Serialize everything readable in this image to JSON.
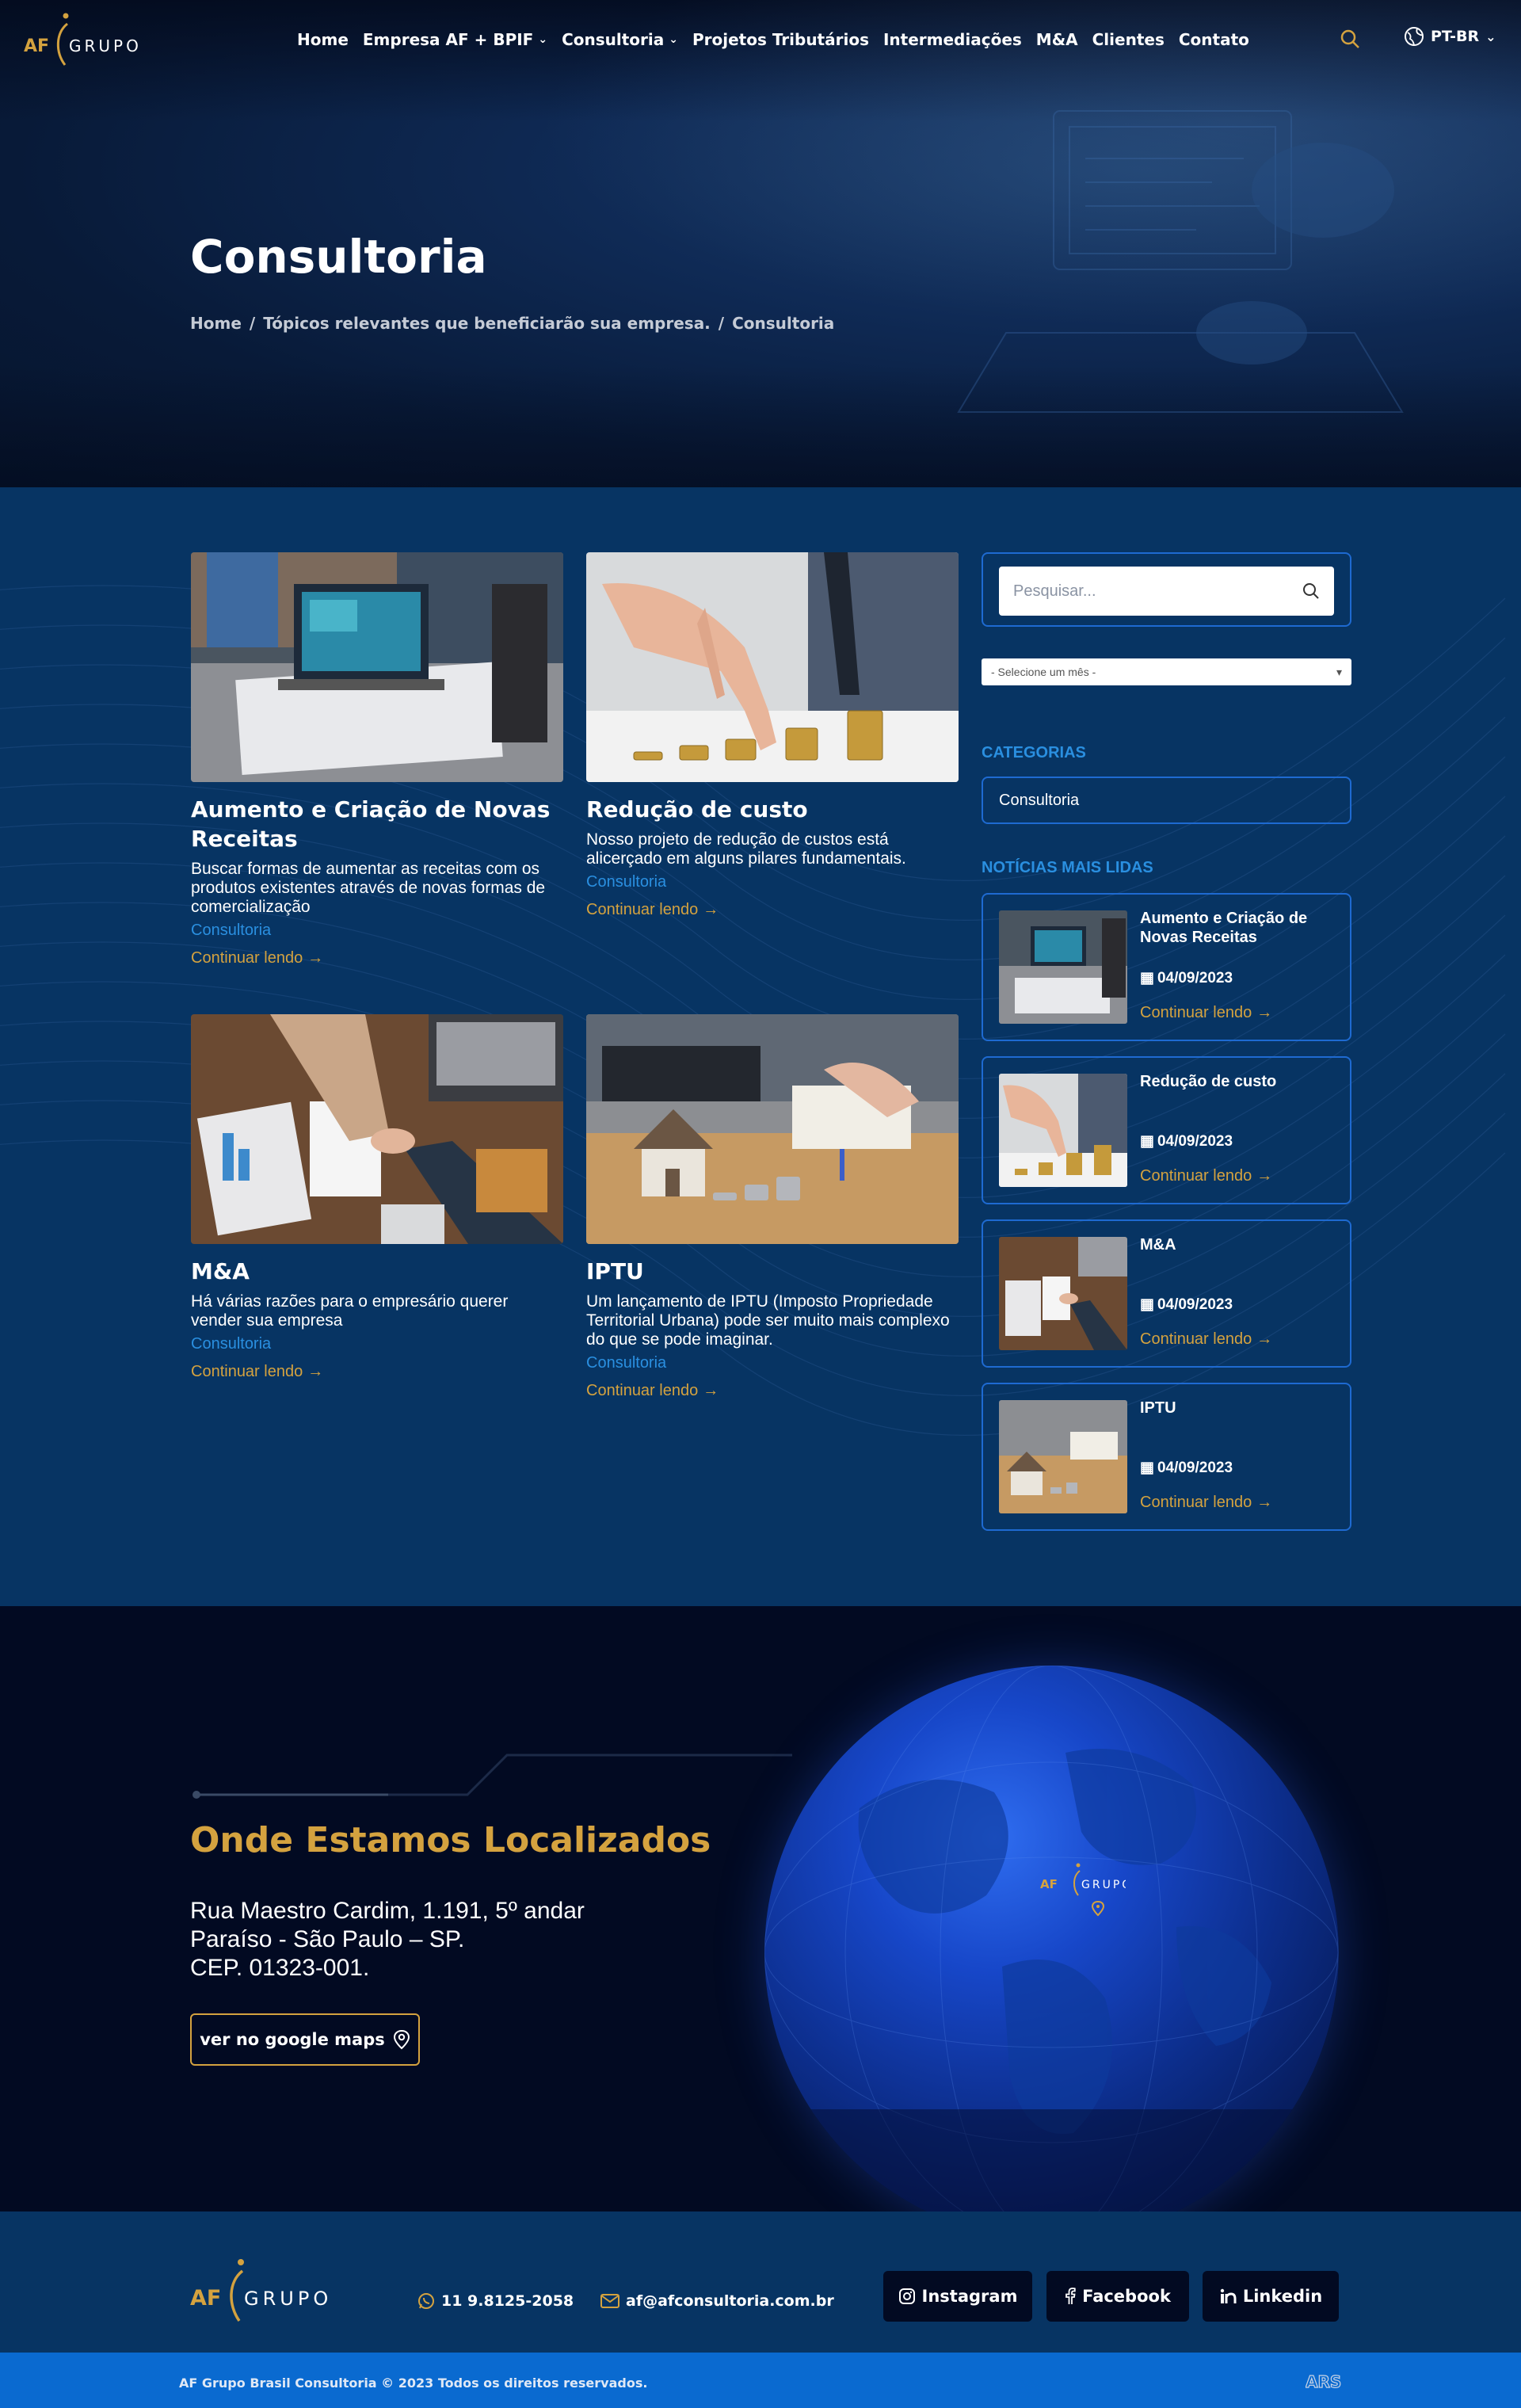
{
  "nav": {
    "logo_af": "AF",
    "logo_grupo": "GRUPO",
    "items": [
      {
        "label": "Home",
        "has_dropdown": false
      },
      {
        "label": "Empresa AF + BPIF",
        "has_dropdown": true
      },
      {
        "label": "Consultoria",
        "has_dropdown": true
      },
      {
        "label": "Projetos Tributários",
        "has_dropdown": false
      },
      {
        "label": "Intermediações",
        "has_dropdown": false
      },
      {
        "label": "M&A",
        "has_dropdown": false
      },
      {
        "label": "Clientes",
        "has_dropdown": false
      },
      {
        "label": "Contato",
        "has_dropdown": false
      }
    ],
    "language": "PT-BR"
  },
  "hero": {
    "title": "Consultoria",
    "breadcrumb": [
      "Home",
      "Tópicos relevantes que beneficiarão sua empresa.",
      "Consultoria"
    ],
    "separator": "/"
  },
  "posts": [
    {
      "title": "Aumento e Criação de Novas Receitas",
      "excerpt": "Buscar formas de aumentar as receitas com os produtos existentes através de novas formas de comercialização",
      "category": "Consultoria",
      "more": "Continuar lendo"
    },
    {
      "title": "Redução de custo",
      "excerpt": "Nosso projeto de redução de custos está alicerçado em alguns pilares fundamentais.",
      "category": "Consultoria",
      "more": "Continuar lendo"
    },
    {
      "title": "M&A",
      "excerpt": "Há várias razões para o empresário querer vender sua empresa",
      "category": "Consultoria",
      "more": "Continuar lendo"
    },
    {
      "title": "IPTU",
      "excerpt": "Um lançamento de IPTU (Imposto Propriedade Territorial Urbana) pode ser muito mais complexo do que se pode imaginar.",
      "category": "Consultoria",
      "more": "Continuar lendo"
    }
  ],
  "sidebar": {
    "search_placeholder": "Pesquisar...",
    "month_select": "- Selecione um mês -",
    "categories_heading": "CATEGORIAS",
    "categories": [
      "Consultoria"
    ],
    "popular_heading": "NOTÍCIAS MAIS LIDAS",
    "popular": [
      {
        "title": "Aumento e Criação de Novas Receitas",
        "date": "04/09/2023",
        "more": "Continuar lendo"
      },
      {
        "title": "Redução de custo",
        "date": "04/09/2023",
        "more": "Continuar lendo"
      },
      {
        "title": "M&A",
        "date": "04/09/2023",
        "more": "Continuar lendo"
      },
      {
        "title": "IPTU",
        "date": "04/09/2023",
        "more": "Continuar lendo"
      }
    ]
  },
  "location": {
    "title": "Onde Estamos Localizados",
    "address_line1": "Rua Maestro Cardim, 1.191, 5º andar",
    "address_line2": "Paraíso - São Paulo – SP.",
    "address_line3": "CEP. 01323-001.",
    "maps_button": "ver no google maps"
  },
  "footer": {
    "phone": "11 9.8125-2058",
    "email": "af@afconsultoria.com.br",
    "social": [
      "Instagram",
      "Facebook",
      "Linkedin"
    ],
    "copyright": "AF Grupo Brasil Consultoria © 2023 Todos os direitos reservados.",
    "credit": "ARS"
  },
  "colors": {
    "gold": "#d4a23f",
    "accent_blue": "#2a8fe0",
    "border_blue": "#1e6ad1",
    "section_blue": "#073463",
    "dark": "#020a22"
  }
}
